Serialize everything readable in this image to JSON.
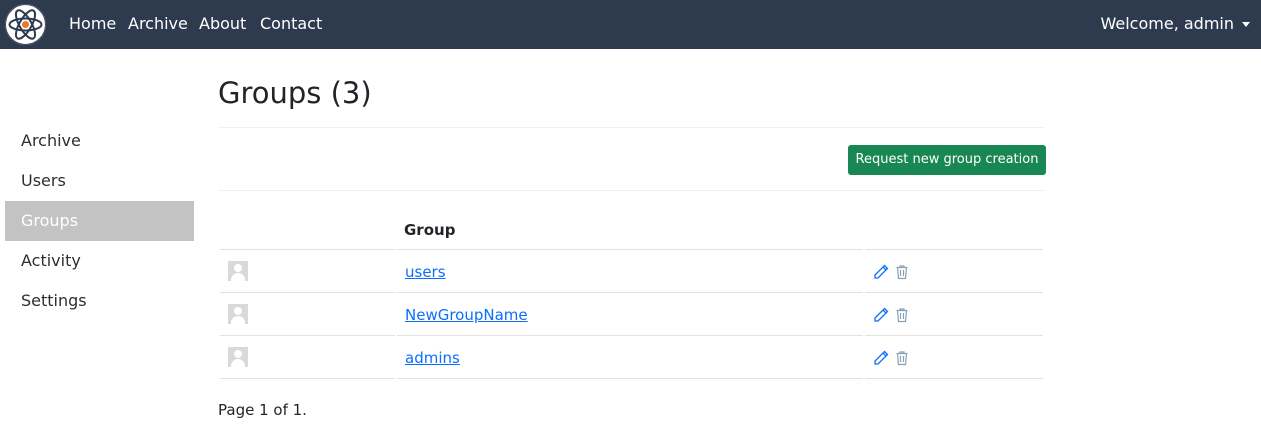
{
  "navbar": {
    "links": [
      "Home",
      "Archive",
      "About",
      "Contact"
    ],
    "user_menu": "Welcome, admin"
  },
  "sidebar": {
    "items": [
      {
        "label": "Archive"
      },
      {
        "label": "Users"
      },
      {
        "label": "Groups",
        "active": true
      },
      {
        "label": "Activity"
      },
      {
        "label": "Settings"
      }
    ]
  },
  "main": {
    "title": "Groups (3)",
    "request_button": "Request new group creation",
    "table": {
      "header": "Group",
      "rows": [
        {
          "name": "users"
        },
        {
          "name": "NewGroupName"
        },
        {
          "name": "admins"
        }
      ]
    },
    "pager": "Page 1 of 1."
  },
  "colors": {
    "navbar_bg": "#2e3b4e",
    "sidebar_active_bg": "#c3c3c3",
    "button_green": "#198754",
    "link_blue": "#0d6efd"
  }
}
